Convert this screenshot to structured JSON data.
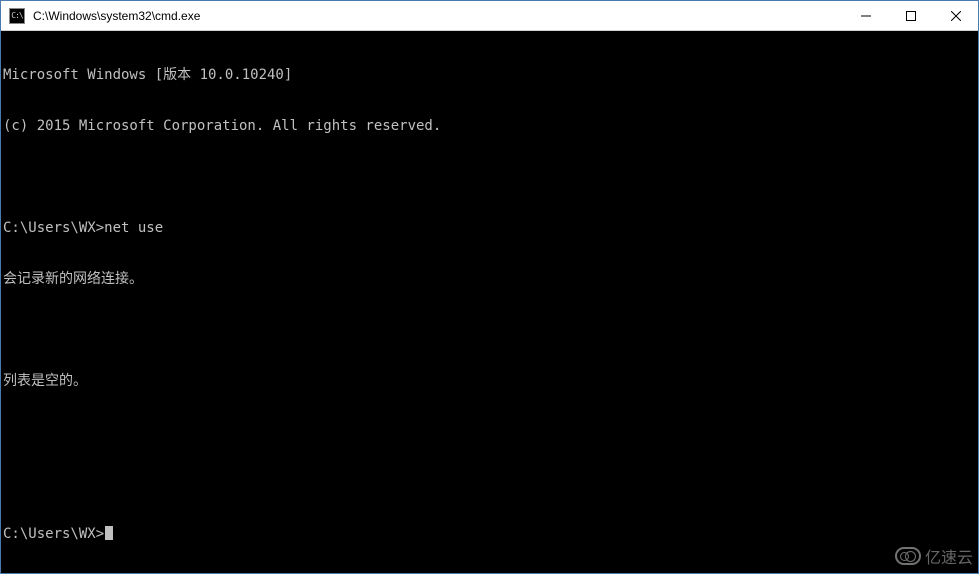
{
  "window": {
    "title": "C:\\Windows\\system32\\cmd.exe",
    "icon_label": "cmd"
  },
  "terminal": {
    "banner_line1": "Microsoft Windows [版本 10.0.10240]",
    "banner_line2": "(c) 2015 Microsoft Corporation. All rights reserved.",
    "prompt1_path": "C:\\Users\\WX>",
    "prompt1_command": "net use",
    "output_line1": "会记录新的网络连接。",
    "output_line2": "列表是空的。",
    "prompt2_path": "C:\\Users\\WX>",
    "prompt2_command": ""
  },
  "watermark": {
    "text": "亿速云"
  }
}
